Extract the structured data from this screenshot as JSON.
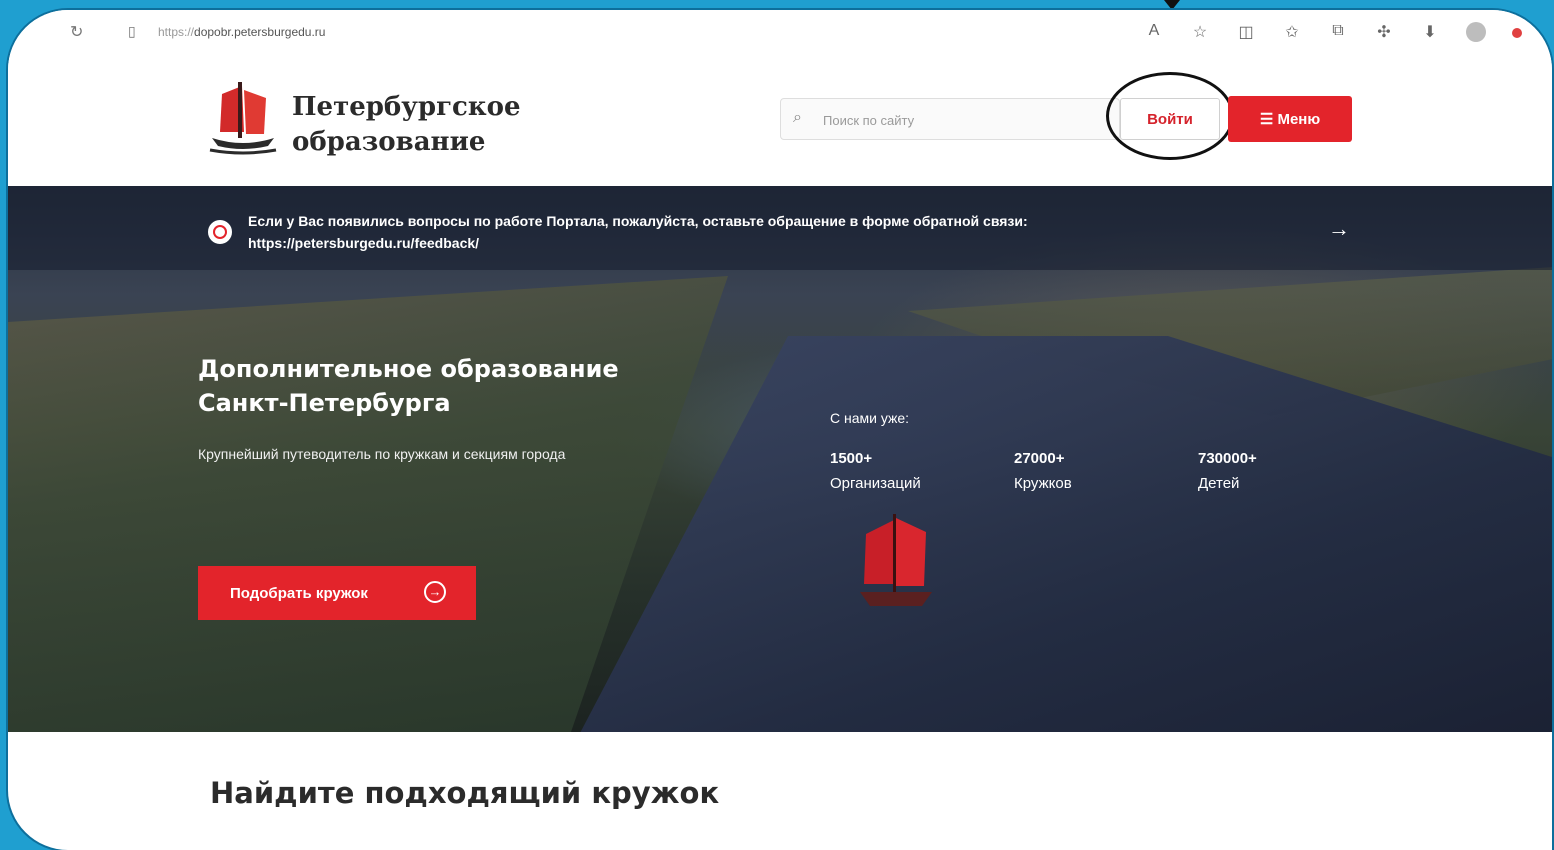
{
  "browser": {
    "url_scheme": "https://",
    "url_host": "dopobr.petersburgedu.ru"
  },
  "header": {
    "brand_line1": "Петербургское",
    "brand_line2": "образование",
    "search_placeholder": "Поиск по сайту",
    "login_label": "Войти",
    "menu_label": "Меню"
  },
  "notice": {
    "text": "Если у Вас появились вопросы по работе Портала, пожалуйста, оставьте обращение в форме обратной связи:",
    "link": "https://petersburgedu.ru/feedback/"
  },
  "hero": {
    "title_line1": "Дополнительное образование",
    "title_line2": "Санкт-Петербурга",
    "subtitle": "Крупнейший путеводитель по кружкам и секциям города",
    "stats_label": "С нами уже:",
    "stats": [
      {
        "value": "1500+",
        "label": "Организаций"
      },
      {
        "value": "27000+",
        "label": "Кружков"
      },
      {
        "value": "730000+",
        "label": "Детей"
      }
    ],
    "cta_label": "Подобрать кружок"
  },
  "section": {
    "title": "Найдите подходящий кружок"
  },
  "colors": {
    "accent": "#e3242b",
    "frame": "#1f9fd0"
  }
}
